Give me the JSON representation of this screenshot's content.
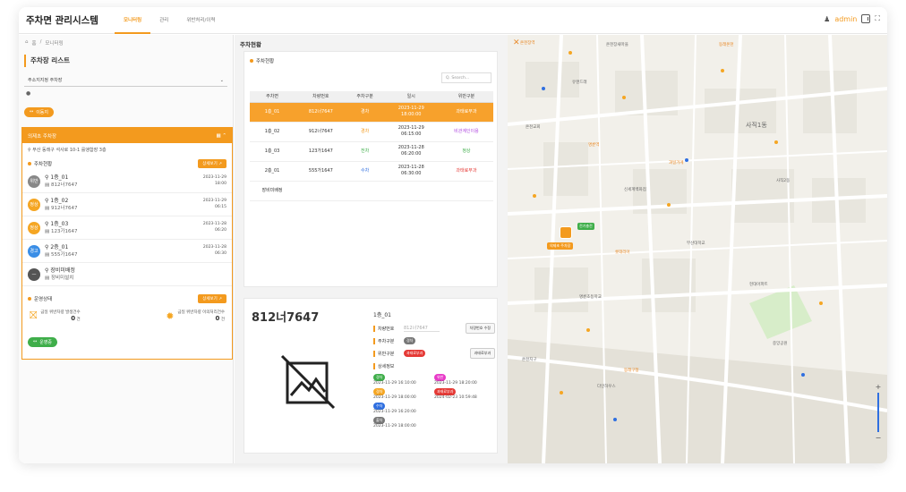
{
  "app": {
    "title": "주차면 관리시스템"
  },
  "nav": {
    "tabs": [
      "모니터링",
      "관리",
      "위반처리/이력"
    ]
  },
  "user": {
    "name": "admin"
  },
  "breadcrumb": [
    "홈",
    "모니터링"
  ],
  "sidebar": {
    "list_title": "주차장 리스트",
    "select_value": "주소지지정 주차장",
    "move_button": "이동지",
    "lot": {
      "name": "의제초 주차장",
      "address": "부산 동래구 석사로 10-1 를앵함장 3층",
      "status_section": "주차현황",
      "detail_button": "상세보기",
      "spaces": [
        {
          "name": "1층_01",
          "plate": "812너7647",
          "time": "2023-11-29\n18:00",
          "icon_text": "위반",
          "color": "#888888"
        },
        {
          "name": "1층_02",
          "plate": "912너7647",
          "time": "2023-11-29\n06:15",
          "icon_text": "정상",
          "color": "#f5a623"
        },
        {
          "name": "1층_03",
          "plate": "123가1647",
          "time": "2023-11-28\n06:20",
          "icon_text": "정상",
          "color": "#f5a623"
        },
        {
          "name": "2층_01",
          "plate": "555가1647",
          "time": "2023-11-28\n06:30",
          "icon_text": "경고",
          "color": "#3a8ee6"
        },
        {
          "name": "장비미배정",
          "plate": "장비미설치",
          "time": "",
          "icon_text": "",
          "color": "#555555"
        }
      ],
      "ops_section": "운영상태",
      "ops_detail_button": "상세보기",
      "stat1_label": "금일 위반차량 발생건수",
      "stat1_value": "0",
      "stat1_unit": "건",
      "stat2_label": "금일 위반차량 이의처리건수",
      "stat2_value": "0",
      "stat2_unit": "건"
    },
    "op_button": "운영중"
  },
  "center": {
    "title": "주차현황",
    "table_section": "주차현황",
    "search_placeholder": "Q. Search...",
    "columns": [
      "주차면",
      "차량번호",
      "주차구분",
      "일시",
      "위반구분"
    ],
    "rows": [
      {
        "space": "1층_01",
        "plate": "812너7647",
        "type": "경차",
        "time": "2023-11-29\n18:00:00",
        "violation": "과태료부과",
        "selected": true
      },
      {
        "space": "1층_02",
        "plate": "912너7647",
        "type": "경차",
        "time": "2023-11-29\n06:15:00",
        "violation": "비관계인이용",
        "selected": false
      },
      {
        "space": "1층_03",
        "plate": "123가1647",
        "type": "전차",
        "time": "2023-11-28\n06:20:00",
        "violation": "정상",
        "selected": false
      },
      {
        "space": "2층_01",
        "plate": "555가1647",
        "type": "수차",
        "time": "2023-11-28\n06:30:00",
        "violation": "과태료부과",
        "selected": false
      },
      {
        "space": "장비미배정",
        "plate": "",
        "type": "",
        "time": "",
        "violation": "",
        "selected": false
      }
    ],
    "detail": {
      "plate": "812너7647",
      "space": "1층_01",
      "plate_label": "차량번호",
      "plate_value": "812너7647",
      "edit_plate_button": "차량번호 수정",
      "parking_type_label": "주차구분",
      "parking_type_pill": "경차",
      "violation_label": "위반구분",
      "violation_pill": "과태료부과",
      "violation_button": "과태료부과",
      "history_label": "상세정보",
      "history": [
        {
          "pill": "경차",
          "color": "#3fae4a",
          "time": "2023-11-29 16:10:00"
        },
        {
          "pill": "위반",
          "color": "#e83ac8",
          "time": "2023-11-29 18:20:00"
        },
        {
          "pill": "경차",
          "color": "#f5a623",
          "time": "2023-11-29 18:00:00"
        },
        {
          "pill": "과태료부과",
          "color": "#e53935",
          "time": "2024-02-23 10:59:48"
        },
        {
          "pill": "수차",
          "color": "#2f6fe0",
          "time": "2023-11-29 16:20:00"
        },
        {
          "pill": "",
          "color": "",
          "time": ""
        },
        {
          "pill": "출차",
          "color": "#777777",
          "time": "2023-11-29 18:00:00"
        },
        {
          "pill": "",
          "color": "",
          "time": ""
        }
      ]
    }
  },
  "map": {
    "lot_label": "의제초 주차장",
    "green_label": "전기충전",
    "labels": [
      {
        "t": "온천장역",
        "o": true
      },
      {
        "t": "온천장새마을",
        "o": false
      },
      {
        "t": "동래온천",
        "o": true
      },
      {
        "t": "유앤드래",
        "o": false
      },
      {
        "t": "사직1동",
        "o": false
      },
      {
        "t": "사직2동",
        "o": false
      },
      {
        "t": "온천교회",
        "o": false
      },
      {
        "t": "명륜역",
        "o": true
      },
      {
        "t": "과일가게",
        "o": true
      },
      {
        "t": "신세계백화점",
        "o": false
      },
      {
        "t": "부산대학교",
        "o": false
      },
      {
        "t": "롯데리아",
        "o": true
      },
      {
        "t": "명륜초등학교",
        "o": false
      },
      {
        "t": "현대아파트",
        "o": false
      },
      {
        "t": "중앙공원",
        "o": false
      },
      {
        "t": "동래구청",
        "o": true
      },
      {
        "t": "온천지구",
        "o": false
      },
      {
        "t": "다인하우스",
        "o": false
      }
    ]
  }
}
